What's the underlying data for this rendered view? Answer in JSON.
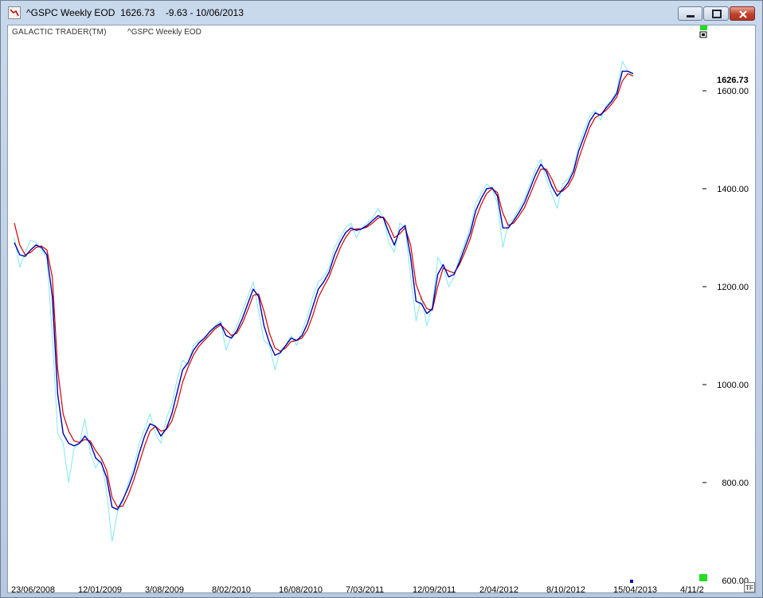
{
  "window": {
    "title": "^GSPC Weekly EOD  1626.73    -9.63 - 10/06/2013",
    "buttons": [
      "minimize",
      "maximize",
      "close"
    ]
  },
  "chart_header": {
    "left": "GALACTIC TRADER(TM)",
    "right": "^GSPC Weekly EOD"
  },
  "colors": {
    "price": "#7fe8f0",
    "fast": "#0000b0",
    "slow": "#d00000",
    "marker": "#22dd22"
  },
  "corner_button": "TF",
  "chart_data": {
    "type": "line",
    "title": "^GSPC Weekly EOD",
    "last_value_label": "1626.73",
    "y_ticks": [
      "600.00",
      "800.00",
      "1000.00",
      "1200.00",
      "1400.00",
      "1600.00"
    ],
    "ylim": [
      600,
      1700
    ],
    "x_ticks": [
      "23/06/2008",
      "12/01/2009",
      "3/08/2009",
      "8/02/2010",
      "16/08/2010",
      "7/03/2011",
      "12/09/2011",
      "2/04/2012",
      "8/10/2012",
      "15/04/2013",
      "4/11/2"
    ],
    "grid": false,
    "series": [
      {
        "id": "price",
        "values": [
          1300,
          1240,
          1270,
          1295,
          1290,
          1275,
          1260,
          1100,
          900,
          880,
          800,
          870,
          880,
          930,
          860,
          830,
          850,
          780,
          680,
          740,
          760,
          800,
          830,
          880,
          910,
          940,
          900,
          880,
          930,
          960,
          1010,
          1050,
          1040,
          1080,
          1090,
          1090,
          1110,
          1120,
          1130,
          1070,
          1100,
          1120,
          1150,
          1180,
          1210,
          1150,
          1090,
          1080,
          1030,
          1070,
          1080,
          1100,
          1080,
          1110,
          1140,
          1180,
          1210,
          1220,
          1240,
          1280,
          1300,
          1320,
          1330,
          1300,
          1320,
          1330,
          1340,
          1360,
          1340,
          1290,
          1270,
          1330,
          1320,
          1220,
          1130,
          1180,
          1120,
          1160,
          1260,
          1240,
          1200,
          1220,
          1260,
          1290,
          1320,
          1370,
          1390,
          1410,
          1400,
          1370,
          1280,
          1330,
          1340,
          1360,
          1380,
          1410,
          1440,
          1460,
          1420,
          1390,
          1360,
          1410,
          1420,
          1440,
          1490,
          1520,
          1550,
          1560,
          1540,
          1570,
          1580,
          1600,
          1660,
          1640,
          1630
        ],
        "first_date": "23/06/2008",
        "last_date": "10/06/2013"
      },
      {
        "id": "fast",
        "values": [
          1290,
          1265,
          1262,
          1275,
          1285,
          1280,
          1265,
          1180,
          980,
          900,
          880,
          875,
          880,
          895,
          880,
          850,
          840,
          810,
          750,
          745,
          765,
          790,
          820,
          860,
          895,
          920,
          915,
          895,
          910,
          940,
          985,
          1030,
          1045,
          1070,
          1085,
          1095,
          1108,
          1118,
          1125,
          1100,
          1095,
          1110,
          1135,
          1165,
          1195,
          1180,
          1120,
          1085,
          1060,
          1065,
          1080,
          1095,
          1090,
          1100,
          1125,
          1160,
          1195,
          1210,
          1230,
          1265,
          1290,
          1310,
          1320,
          1315,
          1318,
          1325,
          1335,
          1345,
          1340,
          1310,
          1285,
          1315,
          1325,
          1260,
          1170,
          1165,
          1145,
          1155,
          1225,
          1245,
          1220,
          1225,
          1250,
          1280,
          1310,
          1355,
          1380,
          1400,
          1402,
          1385,
          1320,
          1320,
          1335,
          1352,
          1372,
          1400,
          1428,
          1450,
          1435,
          1405,
          1385,
          1398,
          1412,
          1435,
          1478,
          1508,
          1538,
          1555,
          1550,
          1565,
          1578,
          1595,
          1640,
          1640,
          1635
        ],
        "first_date": "23/06/2008",
        "last_date": "10/06/2013"
      },
      {
        "id": "slow",
        "values": [
          1330,
          1285,
          1265,
          1270,
          1280,
          1283,
          1275,
          1220,
          1030,
          940,
          905,
          885,
          882,
          888,
          885,
          865,
          850,
          825,
          770,
          750,
          752,
          775,
          805,
          840,
          875,
          905,
          915,
          905,
          908,
          925,
          960,
          1005,
          1035,
          1060,
          1078,
          1090,
          1102,
          1114,
          1122,
          1112,
          1100,
          1105,
          1125,
          1152,
          1182,
          1185,
          1150,
          1105,
          1075,
          1068,
          1075,
          1088,
          1090,
          1095,
          1112,
          1142,
          1178,
          1200,
          1220,
          1250,
          1278,
          1300,
          1315,
          1318,
          1318,
          1322,
          1330,
          1340,
          1342,
          1325,
          1300,
          1308,
          1320,
          1285,
          1205,
          1175,
          1155,
          1152,
          1200,
          1238,
          1232,
          1228,
          1245,
          1270,
          1298,
          1338,
          1368,
          1390,
          1400,
          1392,
          1350,
          1325,
          1330,
          1345,
          1362,
          1388,
          1415,
          1440,
          1440,
          1420,
          1395,
          1395,
          1405,
          1425,
          1462,
          1495,
          1525,
          1545,
          1552,
          1560,
          1572,
          1588,
          1620,
          1635,
          1630
        ],
        "first_date": "23/06/2008",
        "last_date": "10/06/2013"
      }
    ]
  }
}
